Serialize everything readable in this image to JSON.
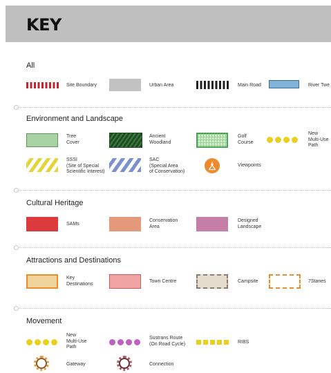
{
  "header": {
    "title": "KEY"
  },
  "sections": {
    "all": {
      "heading": "All",
      "items": {
        "site_boundary": "Site Boundary",
        "urban_area": "Urban Area",
        "main_road": "Main Road",
        "river": "River Twe"
      }
    },
    "environment": {
      "heading": "Environment and Landscape",
      "items": {
        "tree_cover": "Tree\nCover",
        "ancient_woodland": "Ancient\nWoodland",
        "golf_course": "Golf\nCourse",
        "multi_use_path": "New\nMulti-Use\nPath",
        "sssi": "SSSI\n(Site of Special\nScientific Interest)",
        "sac": "SAC\n(Special Area\nof Conservation)",
        "viewpoints": "Viewpoints"
      }
    },
    "cultural": {
      "heading": "Cultural Heritage",
      "items": {
        "sams": "SAMs",
        "conservation_area": "Conservation\nArea",
        "designed_landscape": "Designed\nLandscape"
      }
    },
    "attractions": {
      "heading": "Attractions and Destinations",
      "items": {
        "key_destinations": "Key\nDestinations",
        "town_centre": "Town Centre",
        "campsite": "Campsite",
        "stanes": "7Stanes"
      }
    },
    "movement": {
      "heading": "Movement",
      "items": {
        "multi_use_path": "New\nMulti-Use\nPath",
        "sustrans_route": "Sustrans Route\n(On Road Cycle)",
        "ribs": "RIBS",
        "gateway": "Gateway",
        "connection": "Connection"
      }
    }
  },
  "colors": {
    "header_bg": "#bfbfbf",
    "site_boundary": "#c0282d",
    "urban_area": "#c2c2c2",
    "river": "#82b2d6",
    "tree_cover": "#a8d2a2",
    "ancient_woodland": "#1d4d26",
    "golf_course": "#4fa058",
    "path_yellow": "#ead01e",
    "sssi": "#e3d43a",
    "sac": "#7c8fd0",
    "viewpoint": "#ec8a2c",
    "sams": "#dc3a3c",
    "conservation_area": "#e49a7a",
    "designed_landscape": "#c57ea8",
    "key_destinations_fill": "#efd39a",
    "key_destinations_border": "#ea8d2a",
    "town_centre": "#f0a3a3",
    "campsite": "#e6dcce",
    "stanes_border": "#ea8d2a",
    "sustrans": "#c160c4",
    "gateway": "#e89a3c",
    "connection": "#b05a60"
  },
  "icons": {
    "viewpoints": "viewpoint-icon",
    "gateway": "gateway-ring-icon",
    "connection": "connection-ring-icon"
  }
}
